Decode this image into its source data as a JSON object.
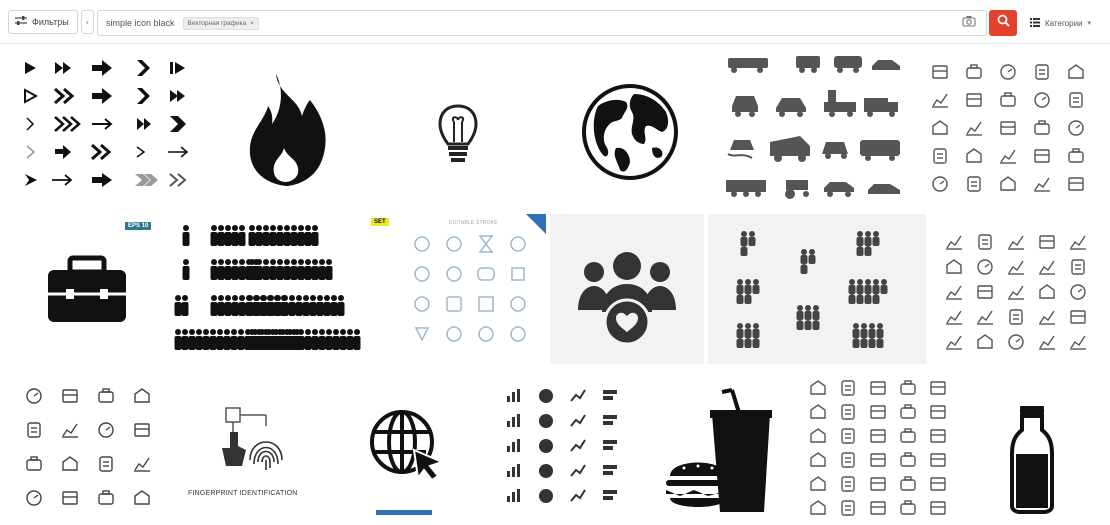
{
  "toolbar": {
    "filters_label": "Фильтры",
    "collapse_glyph": "‹",
    "search_query": "simple icon black",
    "chip_label": "Векторная графика",
    "chip_close": "×",
    "categories_label": "Категории"
  },
  "badges": {
    "eps": "EPS 10",
    "set": "SET",
    "editable": "EDITABLE STROKE"
  },
  "captions": {
    "fingerprint": "FINGERPRINT IDENTIFICATION"
  },
  "colors": {
    "search_button": "#e4412d",
    "icon_black": "#111111",
    "icon_gray": "#555555",
    "badge_teal": "#2f7a8c",
    "badge_yellow": "#f3e32b",
    "badge_blue": "#2f6fb5"
  },
  "icons": [
    "filter-sliders-icon",
    "camera-icon",
    "search-icon",
    "list-icon"
  ]
}
